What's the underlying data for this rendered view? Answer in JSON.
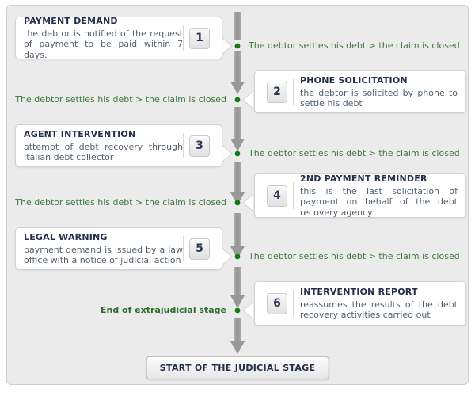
{
  "diagram": {
    "title": "Debt recovery extrajudicial stage flowchart",
    "colors": {
      "panel_bg": "#ebebeb",
      "panel_border": "#cfcfcf",
      "box_bg": "#ffffff",
      "box_border": "#d2d2d2",
      "spine": "#9a9a9a",
      "dot": "#157a15",
      "title_text": "#232f4b",
      "body_text": "#53616e",
      "green_text": "#3f7a3e"
    },
    "steps": [
      {
        "number": "1",
        "title": "PAYMENT DEMAND",
        "body": "the debtor is notified of the request of payment to be paid within 7 days.",
        "side": "left"
      },
      {
        "number": "2",
        "title": "PHONE SOLICITATION",
        "body": "the debtor is solicited by phone to settle his debt",
        "side": "right"
      },
      {
        "number": "3",
        "title": "AGENT INTERVENTION",
        "body": "attempt of debt recovery through Italian debt collector",
        "side": "left"
      },
      {
        "number": "4",
        "title": "2ND PAYMENT REMINDER",
        "body": "this is the last solicitation of payment on behalf of the debt recovery agency",
        "side": "right"
      },
      {
        "number": "5",
        "title": "LEGAL WARNING",
        "body": "payment demand is issued by a law office with a notice of judicial action",
        "side": "left"
      },
      {
        "number": "6",
        "title": "INTERVENTION REPORT",
        "body": "reassumes the results of the debt recovery activities carried out",
        "side": "right"
      }
    ],
    "outcomes": [
      {
        "text": "The debtor settles his debt > the claim is closed",
        "side": "right",
        "bold": false
      },
      {
        "text": "The debtor settles his debt > the claim is closed",
        "side": "left",
        "bold": false
      },
      {
        "text": "The debtor settles his debt > the claim is closed",
        "side": "right",
        "bold": false
      },
      {
        "text": "The debtor settles his debt > the claim is closed",
        "side": "left",
        "bold": false
      },
      {
        "text": "The debtor settles his debt > the claim is closed",
        "side": "right",
        "bold": false
      },
      {
        "text": "End of extrajudicial stage",
        "side": "left",
        "bold": true
      }
    ],
    "end_button": {
      "label": "START OF THE JUDICIAL STAGE"
    }
  }
}
